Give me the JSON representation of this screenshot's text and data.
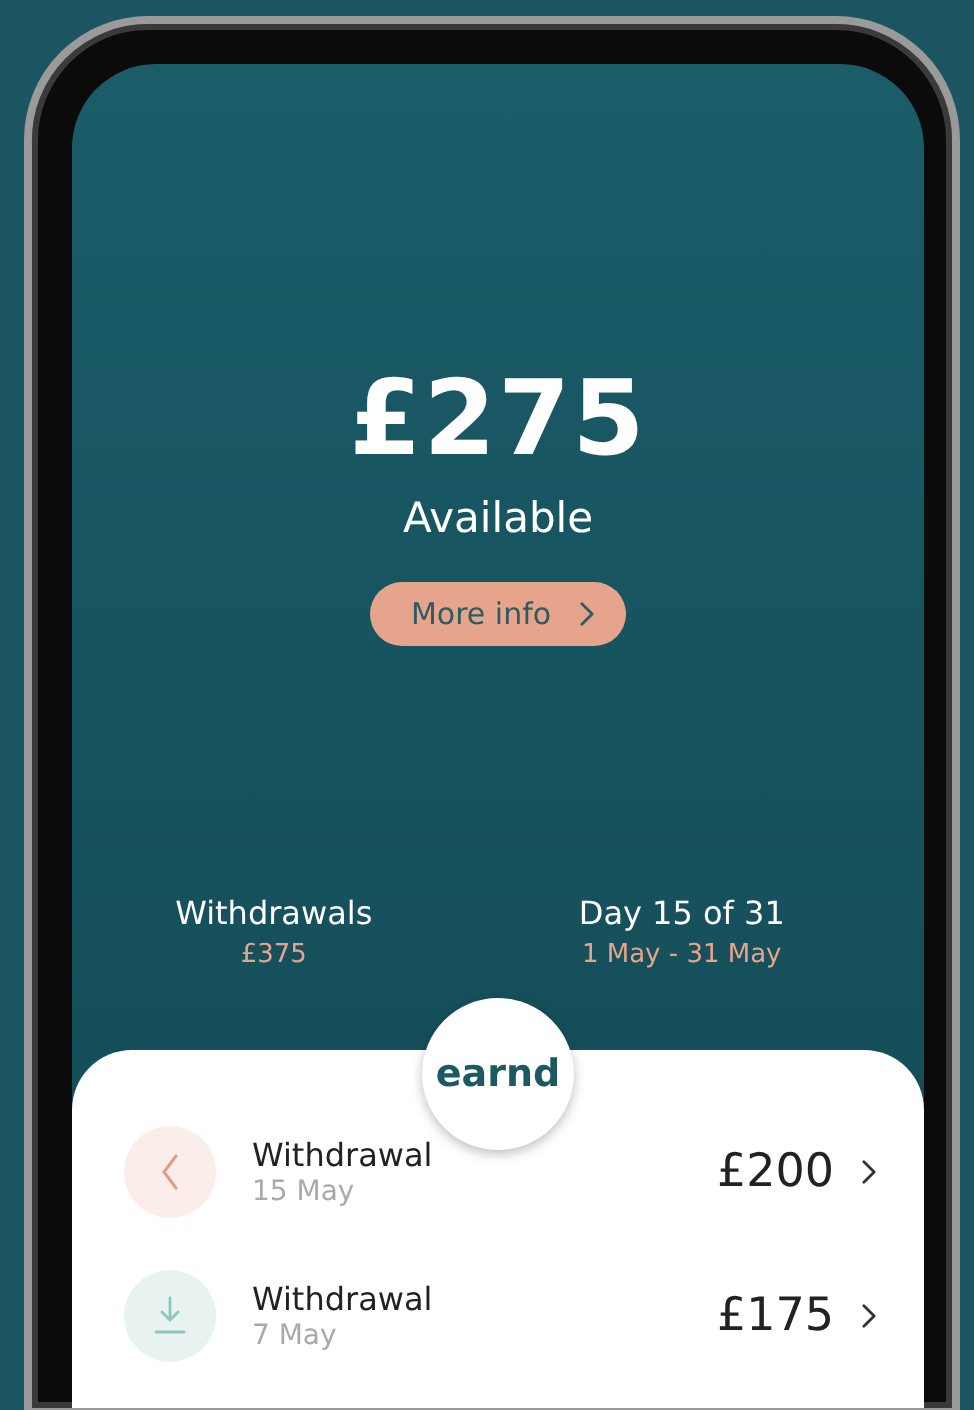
{
  "balance": {
    "amount": "£275",
    "label": "Available",
    "button": "More info"
  },
  "stats": [
    {
      "title": "Withdrawals",
      "value": "£375"
    },
    {
      "title": "Day 15 of 31",
      "value": "1 May - 31 May"
    }
  ],
  "logo": "earnd",
  "transactions": [
    {
      "kind": "pending",
      "title": "Withdrawal",
      "date": "15 May",
      "amount": "£200"
    },
    {
      "kind": "download",
      "title": "Withdrawal",
      "date": "7 May",
      "amount": "£175"
    }
  ]
}
